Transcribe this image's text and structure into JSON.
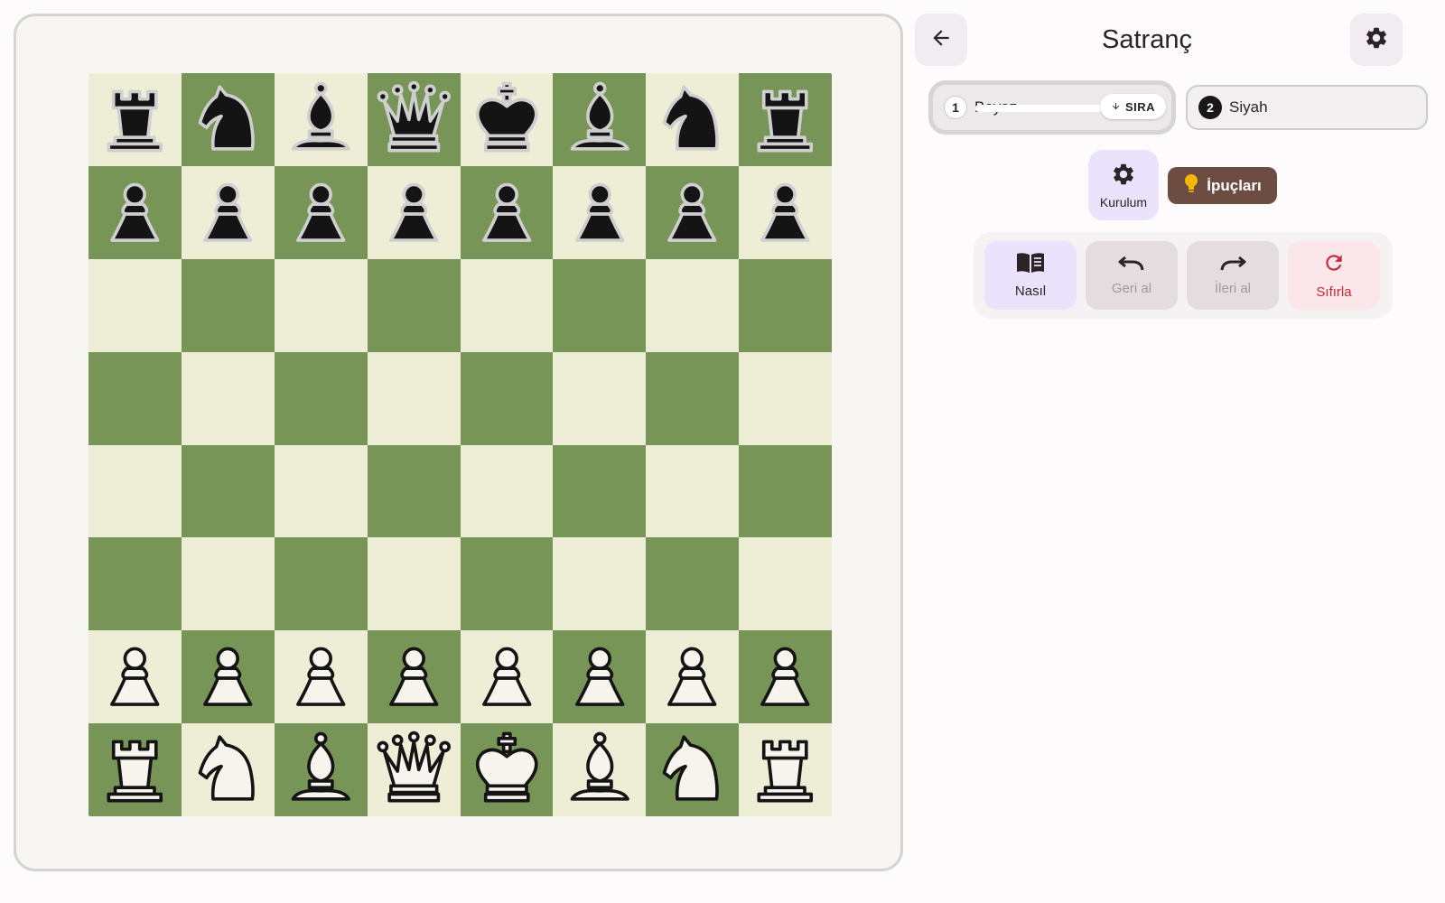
{
  "header": {
    "title": "Satranç",
    "back_icon": "arrow-left-icon",
    "settings_icon": "gear-icon"
  },
  "players": [
    {
      "number": "1",
      "name": "Beyaz",
      "turn_label": "SIRA",
      "active": true
    },
    {
      "number": "2",
      "name": "Siyah",
      "active": false
    }
  ],
  "tools": {
    "setup_label": "Kurulum",
    "hints_label": "İpuçları"
  },
  "actions": {
    "how_label": "Nasıl",
    "undo_label": "Geri al",
    "redo_label": "İleri al",
    "reset_label": "Sıfırla"
  },
  "colors": {
    "light_square": "#eeeed6",
    "dark_square": "#779556",
    "hints_button": "#6d4c41",
    "reset_accent": "#c7283a"
  },
  "board": {
    "orientation": "white-bottom",
    "rows": [
      [
        "br",
        "bn",
        "bb",
        "bq",
        "bk",
        "bb",
        "bn",
        "br"
      ],
      [
        "bp",
        "bp",
        "bp",
        "bp",
        "bp",
        "bp",
        "bp",
        "bp"
      ],
      [
        "",
        "",
        "",
        "",
        "",
        "",
        "",
        ""
      ],
      [
        "",
        "",
        "",
        "",
        "",
        "",
        "",
        ""
      ],
      [
        "",
        "",
        "",
        "",
        "",
        "",
        "",
        ""
      ],
      [
        "",
        "",
        "",
        "",
        "",
        "",
        "",
        ""
      ],
      [
        "wp",
        "wp",
        "wp",
        "wp",
        "wp",
        "wp",
        "wp",
        "wp"
      ],
      [
        "wr",
        "wn",
        "wb",
        "wq",
        "wk",
        "wb",
        "wn",
        "wr"
      ]
    ]
  }
}
